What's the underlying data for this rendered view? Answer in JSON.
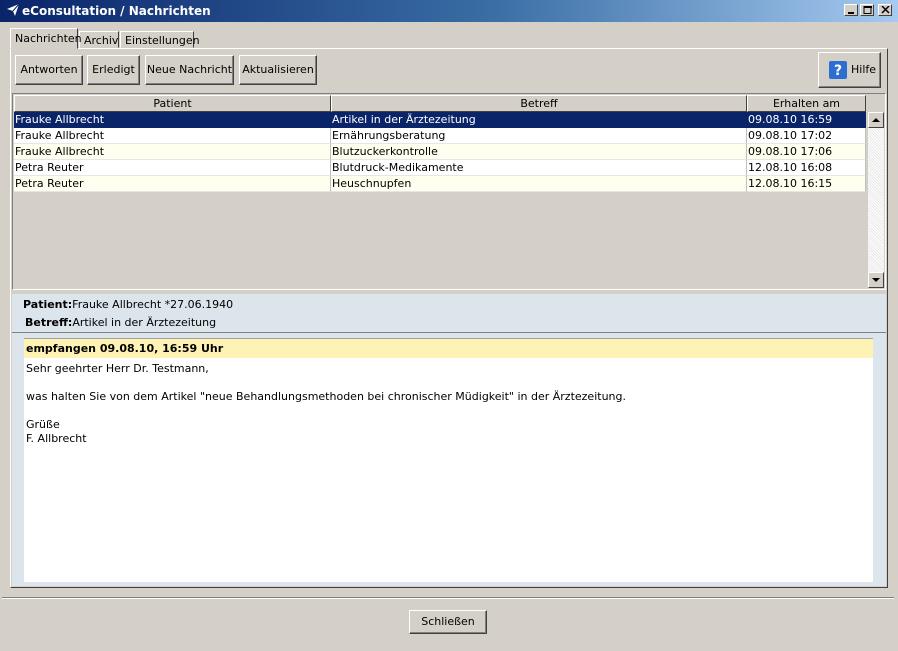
{
  "window": {
    "title": "eConsultation / Nachrichten"
  },
  "tabs": [
    "Nachrichten",
    "Archiv",
    "Einstellungen"
  ],
  "toolbar": {
    "answer": "Antworten",
    "done": "Erledigt",
    "new_message": "Neue Nachricht",
    "refresh": "Aktualisieren",
    "help": "Hilfe"
  },
  "table": {
    "columns": [
      "Patient",
      "Betreff",
      "Erhalten am"
    ],
    "rows": [
      {
        "patient": "Frauke Allbrecht",
        "subject": "Artikel in der Ärztezeitung",
        "received": "09.08.10 16:59"
      },
      {
        "patient": "Frauke Allbrecht",
        "subject": "Ernährungsberatung",
        "received": "09.08.10 17:02"
      },
      {
        "patient": "Frauke Allbrecht",
        "subject": "Blutzuckerkontrolle",
        "received": "09.08.10 17:06"
      },
      {
        "patient": "Petra Reuter",
        "subject": "Blutdruck-Medikamente",
        "received": "12.08.10 16:08"
      },
      {
        "patient": "Petra Reuter",
        "subject": "Heuschnupfen",
        "received": "12.08.10 16:15"
      }
    ]
  },
  "detail": {
    "patient_label": "Patient:",
    "patient_value": "Frauke Allbrecht *27.06.1940",
    "subject_label": "Betreff:",
    "subject_value": "Artikel in der Ärztezeitung"
  },
  "message": {
    "header": "empfangen 09.08.10, 16:59 Uhr",
    "greeting": "Sehr geehrter Herr Dr. Testmann,",
    "body": "was halten Sie von dem Artikel \"neue Behandlungsmethoden bei chronischer Müdigkeit\" in der Ärztezeitung.",
    "closing": "Grüße",
    "signature": "F. Allbrecht"
  },
  "footer": {
    "close": "Schließen"
  },
  "colors": {
    "selection": "#0a246a",
    "message_header": "#fff2b5",
    "detail_bg": "#dce5eb"
  }
}
